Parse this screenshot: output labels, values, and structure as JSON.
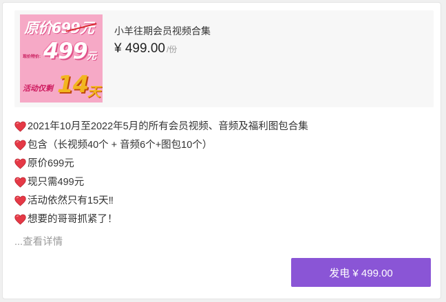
{
  "product": {
    "image_text": {
      "original": "原价699元",
      "now_label": "现价特价:",
      "promo_price": "499",
      "yuan": "元",
      "activity": "活动仅剩",
      "days": "14",
      "tian": "天"
    },
    "title": "小羊往期会员视频合集",
    "price": "¥ 499.00",
    "unit": "/份"
  },
  "description": {
    "lines": [
      "2021年10月至2022年5月的所有会员视频、音频及福利图包合集",
      "包含（长视频40个 + 音频6个+图包10个）",
      "原价699元",
      "现只需499元",
      "活动依然只有15天‼",
      "想要的哥哥抓紧了！"
    ],
    "more_link": "...查看详情",
    "heart_icon": "heart-icon",
    "heart_color": "#e53946"
  },
  "action": {
    "send_label": "发电  ¥ 499.00",
    "button_color": "#8a55d6"
  }
}
